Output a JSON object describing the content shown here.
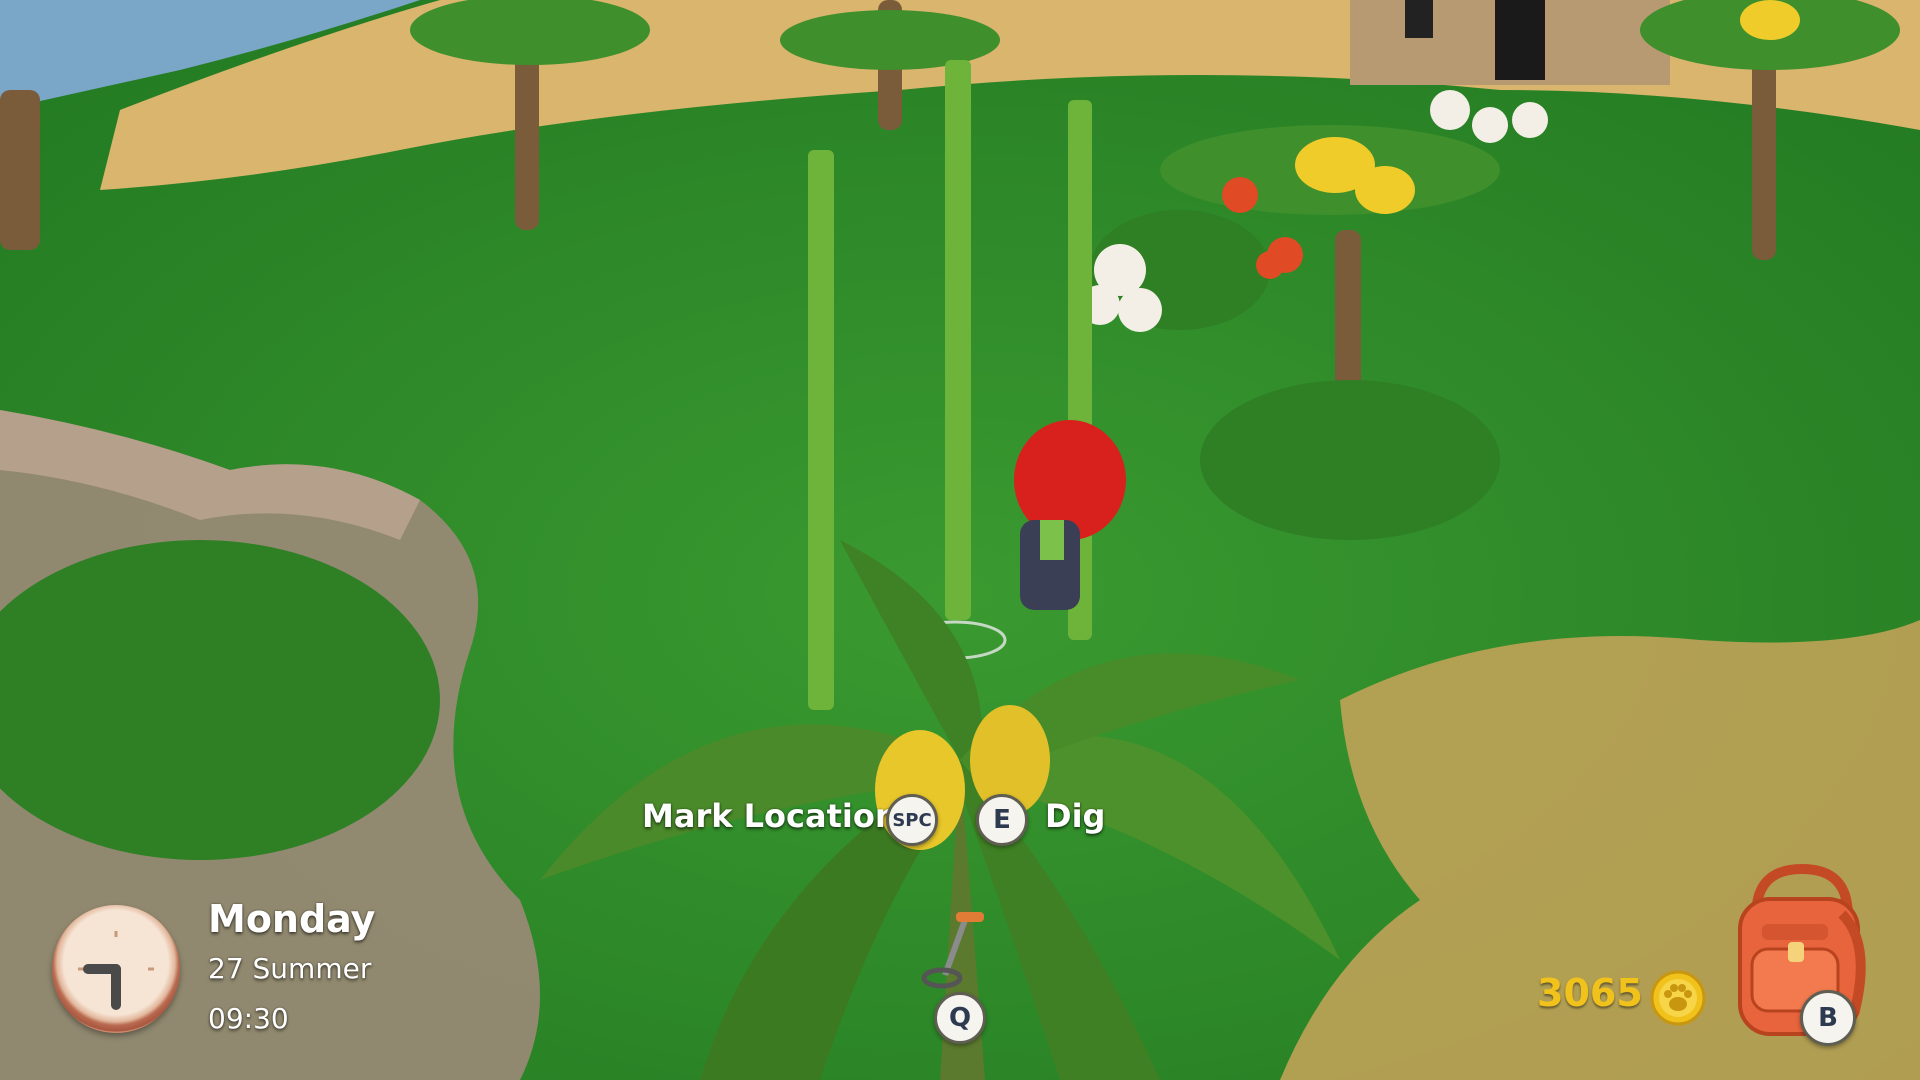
{
  "hud": {
    "day": "Monday",
    "date": "27 Summer",
    "time": "09:30",
    "money": "3065"
  },
  "prompts": {
    "mark_location": "Mark Location",
    "mark_location_key": "SPC",
    "dig_key": "E",
    "dig": "Dig",
    "tool_key": "Q"
  },
  "inventory": {
    "backpack_key": "B"
  },
  "icons": {
    "clock": "analog-clock-icon",
    "coin": "paw-coin-icon",
    "backpack": "backpack-icon",
    "tool": "metal-detector-icon"
  },
  "colors": {
    "grass": "#2f8a2a",
    "sand": "#d9b56e",
    "money": "#f2c21c",
    "backpack": "#e8643c"
  }
}
